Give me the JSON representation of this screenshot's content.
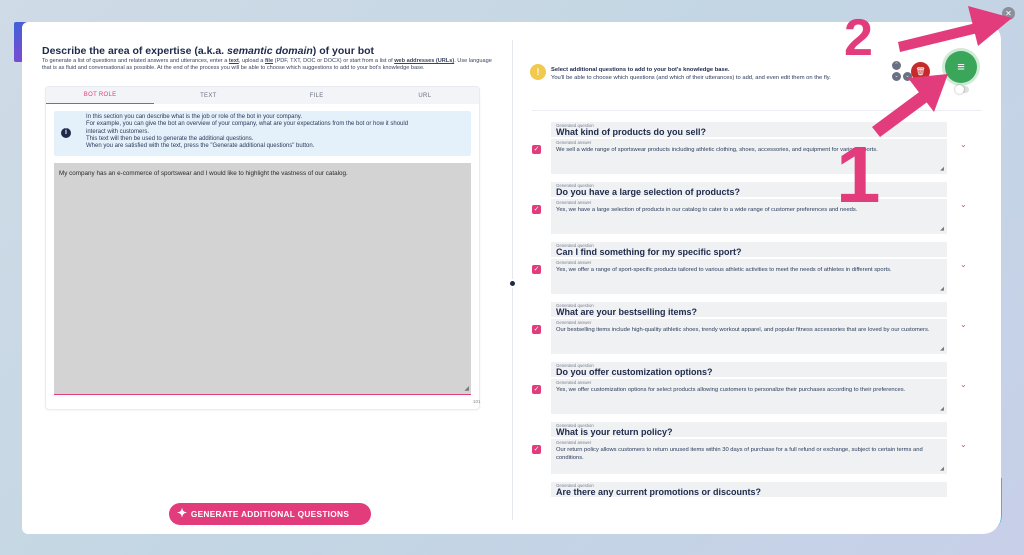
{
  "page": {
    "title_prefix": "Describe the area of expertise (a.k.a. ",
    "title_em": "semantic domain",
    "title_suffix": ") of your bot",
    "intro_1": "To generate a list of questions and related answers and utterances, enter a ",
    "intro_text_link": "text",
    "intro_2": ", upload a ",
    "intro_file_link": "file",
    "intro_3": " (PDF, TXT, DOC or DOCX) or start from a list of ",
    "intro_web_link": "web addresses (URLs)",
    "intro_4": ". Use language that is as fluid and conversational as possible. At the end of the process you will be able to choose which suggestions to add to your bot's knowledge base."
  },
  "tabs": [
    "BOT ROLE",
    "TEXT",
    "FILE",
    "URL"
  ],
  "info": {
    "lines": [
      "In this section you can describe what is the job or role of the bot in your company.",
      "For example, you can give the bot an overview of your company, what are your expectations from the bot or how it should",
      "interact with customers.",
      "This text will then be used to generate the additional questions.",
      "When you are satisfied with the text, press the \"Generate additional questions\" button."
    ]
  },
  "textarea": {
    "value": "My company has an e-commerce of sportswear and I would like to highlight the vastness of our catalog.",
    "counter": "101"
  },
  "generate_button": "GENERATE ADDITIONAL QUESTIONS",
  "right": {
    "warn_title": "Select additional questions to add to your bot's knowledge base.",
    "warn_sub": "You'll be able to choose which questions (and which of their utterances) to add, and even edit them on the fly.",
    "question_label": "Generated question",
    "answer_label": "Generated answer",
    "items": [
      {
        "q": "What kind of products do you sell?",
        "a": "We sell a wide range of sportswear products including athletic clothing, shoes, accessories, and equipment for various sports."
      },
      {
        "q": "Do you have a large selection of products?",
        "a": "Yes, we have a large selection of products in our catalog to cater to a wide range of customer preferences and needs."
      },
      {
        "q": "Can I find something for my specific sport?",
        "a": "Yes, we offer a range of sport-specific products tailored to various athletic activities to meet the needs of athletes in different sports."
      },
      {
        "q": "What are your bestselling items?",
        "a": "Our bestselling items include high-quality athletic shoes, trendy workout apparel, and popular fitness accessories that are loved by our customers."
      },
      {
        "q": "Do you offer customization options?",
        "a": "Yes, we offer customization options for select products allowing customers to personalize their purchases according to their preferences."
      },
      {
        "q": "What is your return policy?",
        "a": "Our return policy allows customers to return unused items within 30 days of purchase for a full refund or exchange, subject to certain terms and conditions."
      },
      {
        "q": "Are there any current promotions or discounts?",
        "a": ""
      }
    ]
  },
  "annotations": {
    "one": "1",
    "two": "2"
  },
  "colors": {
    "accent": "#e23c7c",
    "navy": "#1e2a4a",
    "green": "#3aa65a",
    "danger": "#c62a2a",
    "warning": "#f2c94c",
    "info_bg": "#e4f1fa"
  },
  "icons": [
    "info-icon",
    "warning-icon",
    "delete-icon",
    "add-to-kb-icon",
    "close-icon",
    "sparkle-icon",
    "checkbox-icon",
    "chevron-down-icon"
  ]
}
